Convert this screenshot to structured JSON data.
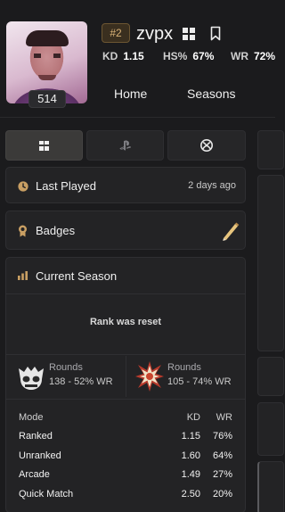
{
  "profile": {
    "level": "514",
    "rank": "#2",
    "username": "zvpx",
    "stats": [
      {
        "label": "KD",
        "value": "1.15"
      },
      {
        "label": "HS%",
        "value": "67%"
      },
      {
        "label": "WR",
        "value": "72%"
      }
    ]
  },
  "nav": {
    "home": "Home",
    "seasons": "Seasons"
  },
  "platforms": [
    "windows-icon",
    "playstation-icon",
    "xbox-icon"
  ],
  "last_played": {
    "label": "Last Played",
    "value": "2 days ago"
  },
  "badges": {
    "label": "Badges"
  },
  "current_season": {
    "title": "Current Season",
    "rank_status": "Rank was reset",
    "rank_cards": [
      {
        "label": "Rounds",
        "value": "138 - 52% WR"
      },
      {
        "label": "Rounds",
        "value": "105 - 74% WR"
      }
    ],
    "table": {
      "headers": [
        "Mode",
        "KD",
        "WR"
      ],
      "rows": [
        [
          "Ranked",
          "1.15",
          "76%"
        ],
        [
          "Unranked",
          "1.60",
          "64%"
        ],
        [
          "Arcade",
          "1.49",
          "27%"
        ],
        [
          "Quick Match",
          "2.50",
          "20%"
        ]
      ]
    }
  },
  "colors": {
    "background": "#1b1b1d",
    "card": "#232325",
    "accent_gold": "#d8a54a"
  }
}
